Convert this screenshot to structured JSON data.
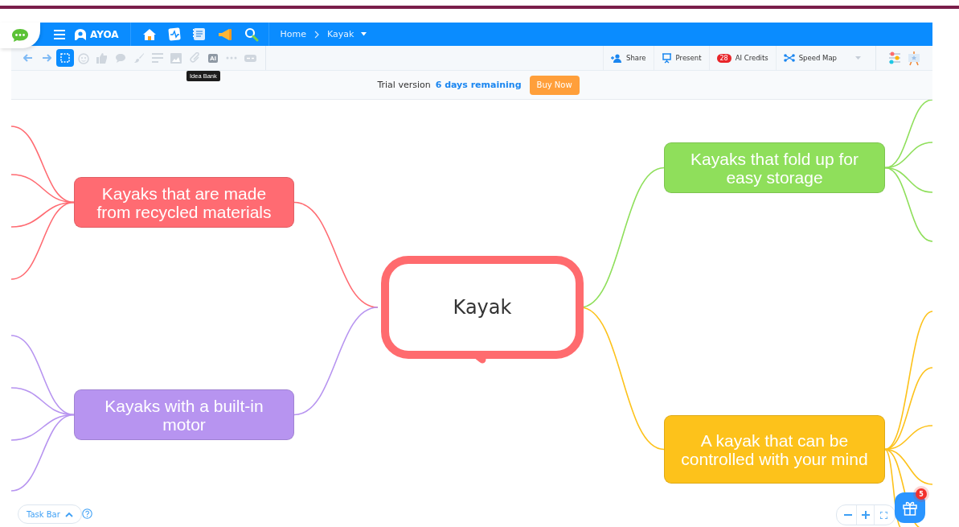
{
  "header": {
    "logo": "AYOA",
    "breadcrumb": [
      {
        "label": "Home"
      },
      {
        "label": "Kayak"
      }
    ]
  },
  "toolbar": {
    "tools": [
      {
        "kind": "undo",
        "selected": false
      },
      {
        "kind": "redo",
        "selected": false
      },
      {
        "kind": "select",
        "selected": true
      },
      {
        "kind": "emoji",
        "selected": false
      },
      {
        "kind": "like",
        "selected": false
      },
      {
        "kind": "comment",
        "selected": false
      },
      {
        "kind": "brush",
        "selected": false
      },
      {
        "kind": "text",
        "selected": false
      },
      {
        "kind": "image",
        "selected": false
      },
      {
        "kind": "attach",
        "selected": false
      },
      {
        "kind": "ai",
        "label": "AI",
        "selected": false
      },
      {
        "kind": "more",
        "selected": false
      },
      {
        "kind": "toggle",
        "selected": false
      }
    ],
    "tooltip": "Idea Bank",
    "actions": [
      {
        "kind": "share",
        "label": "Share"
      },
      {
        "kind": "present",
        "label": "Present"
      },
      {
        "kind": "credits",
        "label": "AI Credits",
        "badge": "28"
      },
      {
        "kind": "speed-map",
        "label": "Speed Map"
      }
    ]
  },
  "trial": {
    "text": "Trial version",
    "remaining": "6 days remaining",
    "button": "Buy Now"
  },
  "mind_map": {
    "center": {
      "label": "Kayak",
      "color": "#ff6b6e"
    },
    "branches": [
      {
        "label": "Kayaks that are made from recycled materials",
        "color": "#ff6b72"
      },
      {
        "label": "Kayaks with a built-in motor",
        "color": "#b794f0"
      },
      {
        "label": "Kayaks that fold up for easy storage",
        "color": "#8fdf5b"
      },
      {
        "label": "A kayak that can be controlled with your mind",
        "color": "#fdc21b"
      }
    ]
  },
  "footer": {
    "task_bar": "Task Bar",
    "gift_badge": "5"
  }
}
